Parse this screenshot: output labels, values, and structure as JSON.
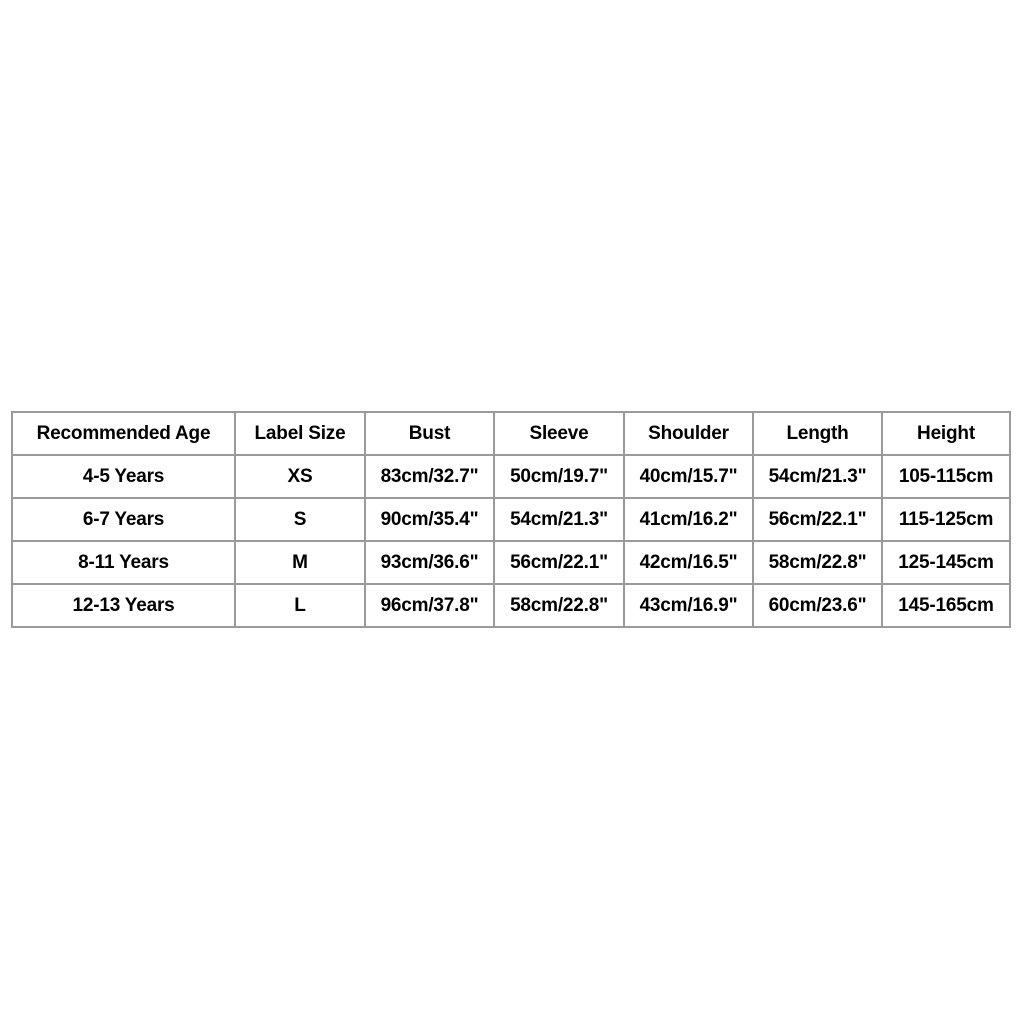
{
  "page": {
    "background_color": "#ffffff",
    "border_color": "#9a9a9a",
    "text_color": "#000000"
  },
  "size_chart": {
    "headers": [
      "Recommended Age",
      "Label Size",
      "Bust",
      "Sleeve",
      "Shoulder",
      "Length",
      "Height"
    ],
    "rows": [
      {
        "age": "4-5 Years",
        "label_size": "XS",
        "bust": "83cm/32.7\"",
        "sleeve": "50cm/19.7\"",
        "shoulder": "40cm/15.7\"",
        "length": "54cm/21.3\"",
        "height": "105-115cm"
      },
      {
        "age": "6-7 Years",
        "label_size": "S",
        "bust": "90cm/35.4\"",
        "sleeve": "54cm/21.3\"",
        "shoulder": "41cm/16.2\"",
        "length": "56cm/22.1\"",
        "height": "115-125cm"
      },
      {
        "age": "8-11 Years",
        "label_size": "M",
        "bust": "93cm/36.6\"",
        "sleeve": "56cm/22.1\"",
        "shoulder": "42cm/16.5\"",
        "length": "58cm/22.8\"",
        "height": "125-145cm"
      },
      {
        "age": "12-13 Years",
        "label_size": "L",
        "bust": "96cm/37.8\"",
        "sleeve": "58cm/22.8\"",
        "shoulder": "43cm/16.9\"",
        "length": "60cm/23.6\"",
        "height": "145-165cm"
      }
    ]
  }
}
